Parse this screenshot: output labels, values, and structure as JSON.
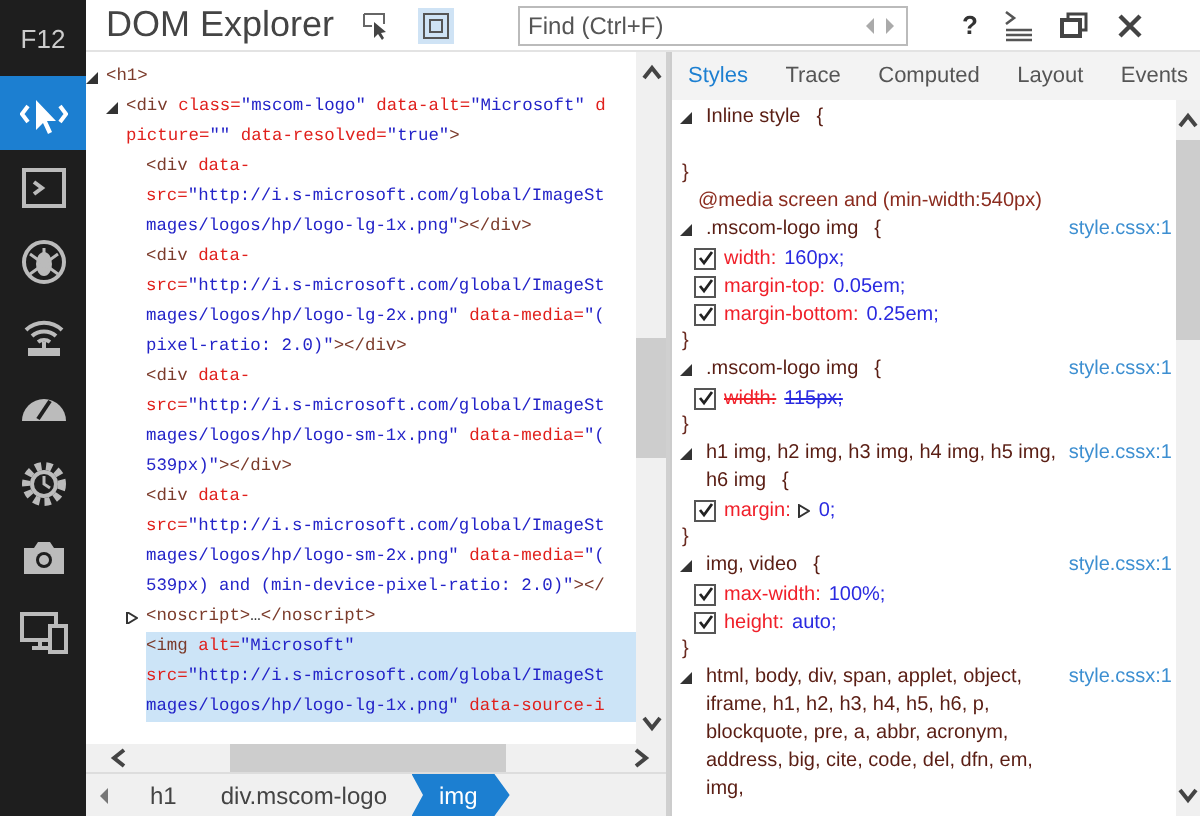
{
  "sidebar": {
    "label": "F12",
    "tools": [
      {
        "kind": "dom",
        "selected": true
      },
      {
        "kind": "console",
        "selected": false
      },
      {
        "kind": "debugger",
        "selected": false
      },
      {
        "kind": "network",
        "selected": false
      },
      {
        "kind": "performance",
        "selected": false
      },
      {
        "kind": "memory",
        "selected": false
      },
      {
        "kind": "emulation",
        "selected": false
      },
      {
        "kind": "devices",
        "selected": false
      }
    ]
  },
  "header": {
    "title": "DOM Explorer",
    "tools": [
      {
        "kind": "select",
        "selected": false
      },
      {
        "kind": "highlight",
        "selected": true
      }
    ],
    "find": {
      "placeholder": "Find (Ctrl+F)"
    },
    "help": "?"
  },
  "dom_tree": [
    {
      "expanded": true,
      "selected": false,
      "lines": [
        [
          {
            "kind": "tag",
            "text": "<h1>"
          }
        ]
      ],
      "children": [
        {
          "expanded": true,
          "selected": false,
          "lines": [
            [
              {
                "kind": "tag",
                "text": "<div"
              },
              {
                "kind": "attr",
                "text": " class="
              },
              {
                "kind": "value",
                "text": "\"mscom-logo\""
              },
              {
                "kind": "attr",
                "text": " data-alt="
              },
              {
                "kind": "value",
                "text": "\"Microsoft\""
              },
              {
                "kind": "attr",
                "text": " d"
              }
            ],
            [
              {
                "kind": "attr",
                "text": "picture="
              },
              {
                "kind": "value",
                "text": "\"\""
              },
              {
                "kind": "attr",
                "text": " data-resolved="
              },
              {
                "kind": "value",
                "text": "\"true\""
              },
              {
                "kind": "tag",
                "text": ">"
              }
            ]
          ],
          "children": [
            {
              "selected": false,
              "lines": [
                [
                  {
                    "kind": "tag",
                    "text": "<div"
                  },
                  {
                    "kind": "attr",
                    "text": " data-"
                  }
                ],
                [
                  {
                    "kind": "attr",
                    "text": "src="
                  },
                  {
                    "kind": "value",
                    "text": "\"http://i.s-microsoft.com/global/ImageSt"
                  }
                ],
                [
                  {
                    "kind": "value",
                    "text": "mages/logos/hp/logo-lg-1x.png\""
                  },
                  {
                    "kind": "tag",
                    "text": "></div>"
                  }
                ]
              ]
            },
            {
              "selected": false,
              "lines": [
                [
                  {
                    "kind": "tag",
                    "text": "<div"
                  },
                  {
                    "kind": "attr",
                    "text": " data-"
                  }
                ],
                [
                  {
                    "kind": "attr",
                    "text": "src="
                  },
                  {
                    "kind": "value",
                    "text": "\"http://i.s-microsoft.com/global/ImageSt"
                  }
                ],
                [
                  {
                    "kind": "value",
                    "text": "mages/logos/hp/logo-lg-2x.png\""
                  },
                  {
                    "kind": "attr",
                    "text": " data-media="
                  },
                  {
                    "kind": "value",
                    "text": "\"("
                  }
                ],
                [
                  {
                    "kind": "value",
                    "text": "pixel-ratio: 2.0)\""
                  },
                  {
                    "kind": "tag",
                    "text": "></div>"
                  }
                ]
              ]
            },
            {
              "selected": false,
              "lines": [
                [
                  {
                    "kind": "tag",
                    "text": "<div"
                  },
                  {
                    "kind": "attr",
                    "text": " data-"
                  }
                ],
                [
                  {
                    "kind": "attr",
                    "text": "src="
                  },
                  {
                    "kind": "value",
                    "text": "\"http://i.s-microsoft.com/global/ImageSt"
                  }
                ],
                [
                  {
                    "kind": "value",
                    "text": "mages/logos/hp/logo-sm-1x.png\""
                  },
                  {
                    "kind": "attr",
                    "text": " data-media="
                  },
                  {
                    "kind": "value",
                    "text": "\"("
                  }
                ],
                [
                  {
                    "kind": "value",
                    "text": "539px)\""
                  },
                  {
                    "kind": "tag",
                    "text": "></div>"
                  }
                ]
              ]
            },
            {
              "selected": false,
              "lines": [
                [
                  {
                    "kind": "tag",
                    "text": "<div"
                  },
                  {
                    "kind": "attr",
                    "text": " data-"
                  }
                ],
                [
                  {
                    "kind": "attr",
                    "text": "src="
                  },
                  {
                    "kind": "value",
                    "text": "\"http://i.s-microsoft.com/global/ImageSt"
                  }
                ],
                [
                  {
                    "kind": "value",
                    "text": "mages/logos/hp/logo-sm-2x.png\""
                  },
                  {
                    "kind": "attr",
                    "text": " data-media="
                  },
                  {
                    "kind": "value",
                    "text": "\"("
                  }
                ],
                [
                  {
                    "kind": "value",
                    "text": "539px) and (min-device-pixel-ratio: 2.0)\""
                  },
                  {
                    "kind": "tag",
                    "text": "></"
                  }
                ]
              ]
            },
            {
              "expanded": false,
              "selected": false,
              "lines": [
                [
                  {
                    "kind": "tag",
                    "text": "<noscript>"
                  },
                  {
                    "kind": "text",
                    "text": "…"
                  },
                  {
                    "kind": "tag",
                    "text": "</noscript>"
                  }
                ]
              ]
            },
            {
              "selected": true,
              "lines": [
                [
                  {
                    "kind": "tag",
                    "text": "<img"
                  },
                  {
                    "kind": "attr",
                    "text": " alt="
                  },
                  {
                    "kind": "value",
                    "text": "\"Microsoft\""
                  }
                ],
                [
                  {
                    "kind": "attr",
                    "text": "src="
                  },
                  {
                    "kind": "value",
                    "text": "\"http://i.s-microsoft.com/global/ImageSt"
                  }
                ],
                [
                  {
                    "kind": "value",
                    "text": "mages/logos/hp/logo-lg-1x.png\""
                  },
                  {
                    "kind": "attr",
                    "text": " data-source-i"
                  }
                ]
              ]
            }
          ]
        }
      ]
    }
  ],
  "breadcrumb": [
    {
      "label": "h1",
      "selected": false
    },
    {
      "label": "div.mscom-logo",
      "selected": false
    },
    {
      "label": "img",
      "selected": true
    }
  ],
  "tabs": [
    {
      "label": "Styles",
      "selected": true
    },
    {
      "label": "Trace",
      "selected": false
    },
    {
      "label": "Computed",
      "selected": false
    },
    {
      "label": "Layout",
      "selected": false
    },
    {
      "label": "Events",
      "selected": false
    }
  ],
  "styles": [
    {
      "kind": "rule",
      "selector": "Inline style",
      "brace": "{",
      "close": "}"
    },
    {
      "kind": "media",
      "text": "@media screen and (min-width:540px)"
    },
    {
      "kind": "rule",
      "selector": ".mscom-logo img",
      "brace": "{",
      "source": "style.cssx:1",
      "close": "}",
      "declarations": [
        {
          "checked": true,
          "overridden": false,
          "property": "width:",
          "value": "160px;"
        },
        {
          "checked": true,
          "overridden": false,
          "property": "margin-top:",
          "value": "0.05em;"
        },
        {
          "checked": true,
          "overridden": false,
          "property": "margin-bottom:",
          "value": "0.25em;"
        }
      ]
    },
    {
      "kind": "rule",
      "selector": ".mscom-logo img",
      "brace": "{",
      "source": "style.cssx:1",
      "close": "}",
      "declarations": [
        {
          "checked": true,
          "overridden": true,
          "property": "width:",
          "value": "115px;"
        }
      ]
    },
    {
      "kind": "rule",
      "selector": "h1 img, h2 img, h3 img, h4 img, h5 img, h6 img",
      "brace": "{",
      "source": "style.cssx:1",
      "close": "}",
      "declarations": [
        {
          "checked": true,
          "overridden": false,
          "expandable": true,
          "property": "margin:",
          "value": "0;"
        }
      ]
    },
    {
      "kind": "rule",
      "selector": "img, video",
      "brace": "{",
      "source": "style.cssx:1",
      "close": "}",
      "declarations": [
        {
          "checked": true,
          "overridden": false,
          "property": "max-width:",
          "value": "100%;"
        },
        {
          "checked": true,
          "overridden": false,
          "property": "height:",
          "value": "auto;"
        }
      ]
    },
    {
      "kind": "rule",
      "selector": "html, body, div, span, applet, object, iframe, h1, h2, h3, h4, h5, h6, p, blockquote, pre, a, abbr, acronym, address, big, cite, code, del, dfn, em, img,",
      "source": "style.cssx:1"
    }
  ]
}
